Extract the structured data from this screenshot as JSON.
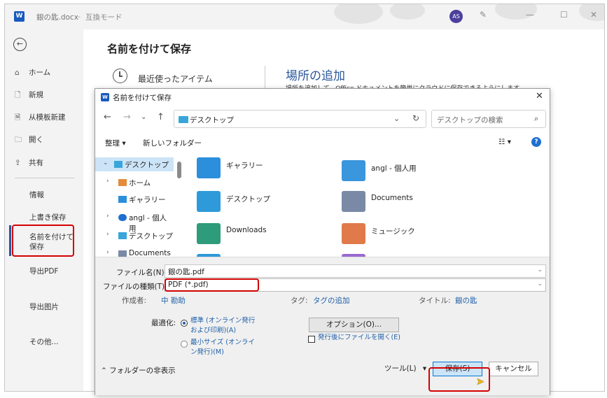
{
  "titlebar": {
    "doc_name": "銀の匙.docx",
    "mode": "互換モード",
    "avatar_initials": "AS"
  },
  "nav": {
    "items": [
      {
        "label": "ホーム",
        "icon": "home-icon"
      },
      {
        "label": "新規",
        "icon": "new-document-icon"
      },
      {
        "label": "从模板新建",
        "icon": "template-icon"
      },
      {
        "label": "開く",
        "icon": "folder-open-icon"
      },
      {
        "label": "共有",
        "icon": "share-icon"
      }
    ],
    "info": "情報",
    "overwrite": "上書き保存",
    "saveas": "名前を付けて\n保存",
    "export_pdf": "导出PDF",
    "export_img": "导出图片",
    "more": "その他..."
  },
  "content": {
    "heading": "名前を付けて保存",
    "recent": "最近使ったアイテム",
    "add_location": "場所の追加",
    "add_location_desc": "場所を追加して、Office ドキュメントを簡単にクラウドに保存できるようにします。"
  },
  "dialog": {
    "title": "名前を付けて保存",
    "address": "デスクトップ",
    "search_placeholder": "デスクトップの検索",
    "organize": "整理",
    "new_folder": "新しいフォルダー",
    "tree": [
      {
        "label": "デスクトップ",
        "icon": "desktop-folder-icon",
        "selected": true
      },
      {
        "label": "ホーム",
        "icon": "home-icon"
      },
      {
        "label": "ギャラリー",
        "icon": "gallery-icon"
      },
      {
        "label": "angl - 個人用",
        "icon": "onedrive-icon"
      },
      {
        "label": "デスクトップ",
        "icon": "desktop-folder-icon"
      },
      {
        "label": "Documents",
        "icon": "documents-icon"
      }
    ],
    "items": [
      {
        "label": "ギャラリー",
        "icon": "gallery-icon",
        "color": "#2b8fdc"
      },
      {
        "label": "angl - 個人用",
        "icon": "onedrive-folder-icon",
        "color": "#3a96dd"
      },
      {
        "label": "デスクトップ",
        "icon": "desktop-folder-icon",
        "color": "#2f9ad9"
      },
      {
        "label": "Documents",
        "icon": "documents-folder-icon",
        "color": "#7a8aa6"
      },
      {
        "label": "Downloads",
        "icon": "downloads-folder-icon",
        "color": "#2e9b7a"
      },
      {
        "label": "ミュージック",
        "icon": "music-folder-icon",
        "color": "#e07a4a"
      }
    ],
    "filename_label": "ファイル名(N):",
    "filename_value": "銀の匙.pdf",
    "filetype_label": "ファイルの種類(T):",
    "filetype_value": "PDF (*.pdf)",
    "author_key": "作成者:",
    "author_val": "中 勘助",
    "tags_key": "タグ:",
    "tags_val": "タグの追加",
    "title_key": "タイトル:",
    "title_val": "銀の匙",
    "optimize_label": "最適化:",
    "opt_standard": "標準 (オンライン発行および印刷)(A)",
    "opt_minimum": "最小サイズ (オンライン発行)(M)",
    "options_button": "オプション(O)...",
    "open_after": "発行後にファイルを開く(E)",
    "hide_folders": "フォルダーの非表示",
    "tools": "ツール(L)",
    "save": "保存(S)",
    "cancel": "キャンセル"
  },
  "colors": {
    "accent": "#2b579a",
    "highlight_box": "#d40000",
    "link": "#1f5fa8"
  }
}
